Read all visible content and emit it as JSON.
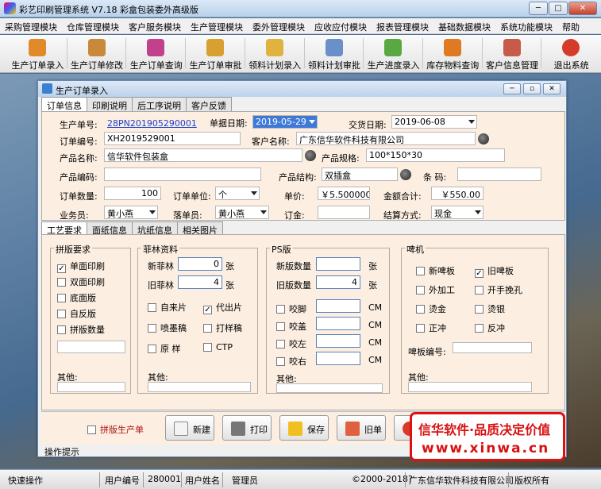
{
  "window": {
    "title": "彩艺印刷管理系统  V7.18 彩盒包装委外高级版"
  },
  "menu": [
    "采购管理模块",
    "仓库管理模块",
    "客户服务模块",
    "生产管理模块",
    "委外管理模块",
    "应收应付模块",
    "报表管理模块",
    "基础数据模块",
    "系统功能模块",
    "帮助"
  ],
  "toolbar": [
    {
      "label": "生产订单录入",
      "icon": "order-entry-icon",
      "color": "#e08a2c"
    },
    {
      "label": "生产订单修改",
      "icon": "order-edit-icon",
      "color": "#c9893a"
    },
    {
      "label": "生产订单查询",
      "icon": "order-query-icon",
      "color": "#c2418c"
    },
    {
      "label": "生产订单审批",
      "icon": "order-approve-icon",
      "color": "#d8a030"
    },
    {
      "label": "领料计划录入",
      "icon": "material-plan-icon",
      "color": "#e0b340"
    },
    {
      "label": "领料计划审批",
      "icon": "material-approve-icon",
      "color": "#6a8fc9"
    },
    {
      "label": "生产进度录入",
      "icon": "progress-icon",
      "color": "#5aa843"
    },
    {
      "label": "库存物料查询",
      "icon": "stock-query-icon",
      "color": "#e07a22"
    },
    {
      "label": "客户信息管理",
      "icon": "customer-icon",
      "color": "#c85a4a"
    },
    {
      "label": "退出系统",
      "icon": "exit-icon",
      "color": "#d63a2a"
    }
  ],
  "child": {
    "title": "生产订单录入",
    "tabs": [
      "订单信息",
      "印刷说明",
      "后工序说明",
      "客户反馈"
    ],
    "fields": {
      "prod_no_label": "生产单号:",
      "prod_no": "28PN201905290001",
      "doc_date_label": "单据日期:",
      "doc_date": "2019-05-29",
      "delivery_label": "交货日期:",
      "delivery": "2019-06-08",
      "order_no_label": "订单编号:",
      "order_no": "XH2019529001",
      "customer_label": "客户名称:",
      "customer": "广东信华软件科技有限公司",
      "product_label": "产品名称:",
      "product": "信华软件包装盒",
      "spec_label": "产品规格:",
      "spec": "100*150*30",
      "code_label": "产品编码:",
      "code": "",
      "struct_label": "产品结构:",
      "struct": "双插盒",
      "barcode_label": "条  码:",
      "barcode": "",
      "qty_label": "订单数量:",
      "qty": "100",
      "unit_label": "订单单位:",
      "unit": "个",
      "price_label": "单价:",
      "price": "￥5.500000",
      "amount_label": "金额合计:",
      "amount": "￥550.00",
      "sales_label": "业务员:",
      "sales": "黄小燕",
      "taker_label": "落单员:",
      "taker": "黄小燕",
      "deposit_label": "订金:",
      "deposit": "",
      "settle_label": "结算方式:",
      "settle": "现金"
    },
    "subtabs": [
      "工艺要求",
      "面纸信息",
      "坑纸信息",
      "相关图片"
    ],
    "pinban": {
      "title": "拼版要求",
      "items": [
        {
          "label": "单面印刷",
          "checked": "✓"
        },
        {
          "label": "双面印刷",
          "checked": ""
        },
        {
          "label": "底面版",
          "checked": ""
        },
        {
          "label": "自反版",
          "checked": ""
        },
        {
          "label": "拼版数量",
          "checked": ""
        }
      ],
      "other_label": "其他:"
    },
    "feilin": {
      "title": "菲林资料",
      "new_label": "新菲林",
      "new_val": "0",
      "old_label": "旧菲林",
      "old_val": "4",
      "unit": "张",
      "checks": [
        {
          "label": "自来片",
          "checked": ""
        },
        {
          "label": "代出片",
          "checked": "✓"
        },
        {
          "label": "喷墨稿",
          "checked": ""
        },
        {
          "label": "打样稿",
          "checked": ""
        },
        {
          "label": "原  样",
          "checked": ""
        },
        {
          "label": "CTP",
          "checked": ""
        }
      ],
      "other_label": "其他:"
    },
    "ps": {
      "title": "PS版",
      "new_label": "新版数量",
      "old_label": "旧版数量",
      "old_val": "4",
      "unit": "张",
      "checks": [
        {
          "label": "咬脚",
          "unit": "CM"
        },
        {
          "label": "咬盖",
          "unit": "CM"
        },
        {
          "label": "咬左",
          "unit": "CM"
        },
        {
          "label": "咬右",
          "unit": "CM"
        }
      ],
      "other_label": "其他:"
    },
    "die": {
      "title": "啤机",
      "checks": [
        {
          "label": "新啤板",
          "checked": ""
        },
        {
          "label": "旧啤板",
          "checked": "✓"
        },
        {
          "label": "外加工",
          "checked": ""
        },
        {
          "label": "开手挽孔",
          "checked": ""
        },
        {
          "label": "烫金",
          "checked": ""
        },
        {
          "label": "烫银",
          "checked": ""
        },
        {
          "label": "正冲",
          "checked": ""
        },
        {
          "label": "反冲",
          "checked": ""
        }
      ],
      "no_label": "啤板编号:",
      "other_label": "其他:"
    },
    "bottom": {
      "pinban_prod": "拼版生产单",
      "new": "新建",
      "print": "打印",
      "save": "保存",
      "old": "旧单"
    },
    "hint": "操作提示"
  },
  "status": {
    "quick": "快速操作",
    "uid_label": "用户编号",
    "uid": "280001",
    "uname_label": "用户姓名",
    "uname": "管理员",
    "copyright": "©2000-2018?",
    "company": "广东信华软件科技有限公司",
    "rights": "版权所有"
  },
  "banner": {
    "line1": "信华软件·品质决定价值",
    "line2": "www.xinwa.cn"
  }
}
